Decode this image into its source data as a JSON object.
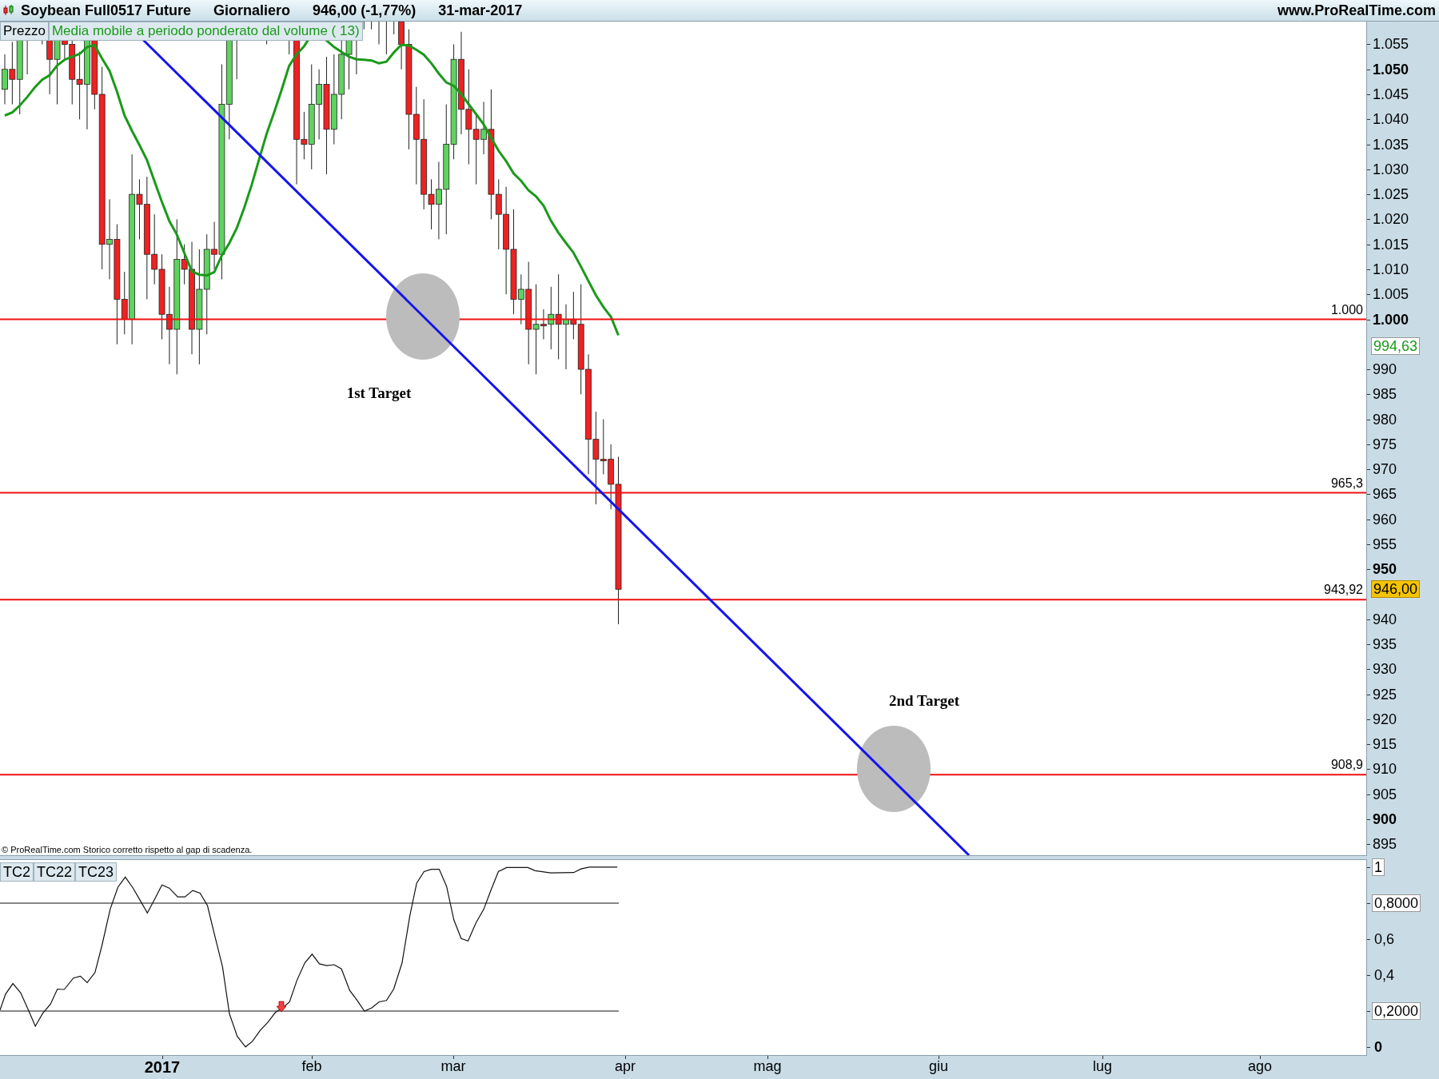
{
  "header": {
    "instrument": "Soybean Full0517 Future",
    "period": "Giornaliero",
    "last": "946,00 (-1,77%)",
    "date": "31-mar-2017",
    "site": "www.ProRealTime.com"
  },
  "price_panel": {
    "legend": [
      {
        "text": "Prezzo",
        "kind": "price"
      },
      {
        "text": "Media mobile a periodo ponderato dal volume ( 13)",
        "kind": "indicator"
      }
    ],
    "levels": [
      {
        "label": "1.000"
      },
      {
        "label": "965,3"
      },
      {
        "label": "943,92"
      },
      {
        "label": "908,9"
      }
    ],
    "annotations": [
      "1st Target",
      "2nd Target"
    ],
    "axis_ticks": [
      {
        "label": "1.055",
        "major": false
      },
      {
        "label": "1.050",
        "major": true
      },
      {
        "label": "1.045",
        "major": false
      },
      {
        "label": "1.040",
        "major": false
      },
      {
        "label": "1.035",
        "major": false
      },
      {
        "label": "1.030",
        "major": false
      },
      {
        "label": "1.025",
        "major": false
      },
      {
        "label": "1.020",
        "major": false
      },
      {
        "label": "1.015",
        "major": false
      },
      {
        "label": "1.010",
        "major": false
      },
      {
        "label": "1.005",
        "major": false
      },
      {
        "label": "1.000",
        "major": true
      },
      {
        "label": "990",
        "major": false
      },
      {
        "label": "985",
        "major": false
      },
      {
        "label": "980",
        "major": false
      },
      {
        "label": "975",
        "major": false
      },
      {
        "label": "970",
        "major": false
      },
      {
        "label": "965",
        "major": false
      },
      {
        "label": "960",
        "major": false
      },
      {
        "label": "955",
        "major": false
      },
      {
        "label": "950",
        "major": true
      },
      {
        "label": "940",
        "major": false
      },
      {
        "label": "935",
        "major": false
      },
      {
        "label": "930",
        "major": false
      },
      {
        "label": "925",
        "major": false
      },
      {
        "label": "920",
        "major": false
      },
      {
        "label": "915",
        "major": false
      },
      {
        "label": "910",
        "major": false
      },
      {
        "label": "905",
        "major": false
      },
      {
        "label": "900",
        "major": true
      },
      {
        "label": "895",
        "major": false
      }
    ],
    "badges": [
      {
        "label": "994,63",
        "kind": "indicator"
      },
      {
        "label": "946,00",
        "kind": "price"
      }
    ],
    "footnote": "© ProRealTime.com Storico corretto rispetto al gap di scadenza."
  },
  "oscillator_panel": {
    "legend": [
      "TC2",
      "TC22",
      "TC23"
    ],
    "axis_ticks": [
      {
        "label": "1",
        "major": false,
        "boxed": true
      },
      {
        "label": "0,8000",
        "major": false,
        "boxed": true
      },
      {
        "label": "0,6",
        "major": false,
        "boxed": false
      },
      {
        "label": "0,4",
        "major": false,
        "boxed": false
      },
      {
        "label": "0,2000",
        "major": false,
        "boxed": true
      },
      {
        "label": "0",
        "major": true,
        "boxed": false
      }
    ]
  },
  "time_axis": [
    {
      "label": "2017",
      "major": true
    },
    {
      "label": "feb",
      "major": false
    },
    {
      "label": "mar",
      "major": false
    },
    {
      "label": "apr",
      "major": false
    },
    {
      "label": "mag",
      "major": false
    },
    {
      "label": "giu",
      "major": false
    },
    {
      "label": "lug",
      "major": false
    },
    {
      "label": "ago",
      "major": false
    }
  ]
}
